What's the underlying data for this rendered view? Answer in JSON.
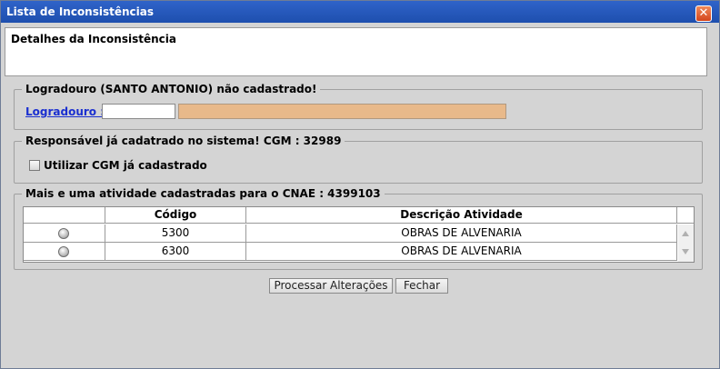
{
  "window": {
    "title": "Lista de Inconsistências",
    "close_glyph": "✕"
  },
  "details": {
    "title": "Detalhes da Inconsistência"
  },
  "logradouro_group": {
    "legend": "Logradouro (SANTO ANTONIO) não cadastrado!",
    "link_label": "Logradouro :",
    "code_value": "",
    "name_value": ""
  },
  "cgm_group": {
    "legend": "Responsável já cadatrado no sistema! CGM : 32989",
    "checkbox_label": "Utilizar CGM já cadastrado"
  },
  "atividade_group": {
    "legend": "Mais e uma atividade cadastradas para o CNAE : 4399103",
    "columns": [
      "",
      "Código",
      "Descrição Atividade"
    ],
    "rows": [
      {
        "codigo": "5300",
        "descricao": "OBRAS DE ALVENARIA"
      },
      {
        "codigo": "6300",
        "descricao": "OBRAS DE ALVENARIA"
      }
    ]
  },
  "buttons": {
    "process": "Processar Alterações",
    "close": "Fechar"
  }
}
